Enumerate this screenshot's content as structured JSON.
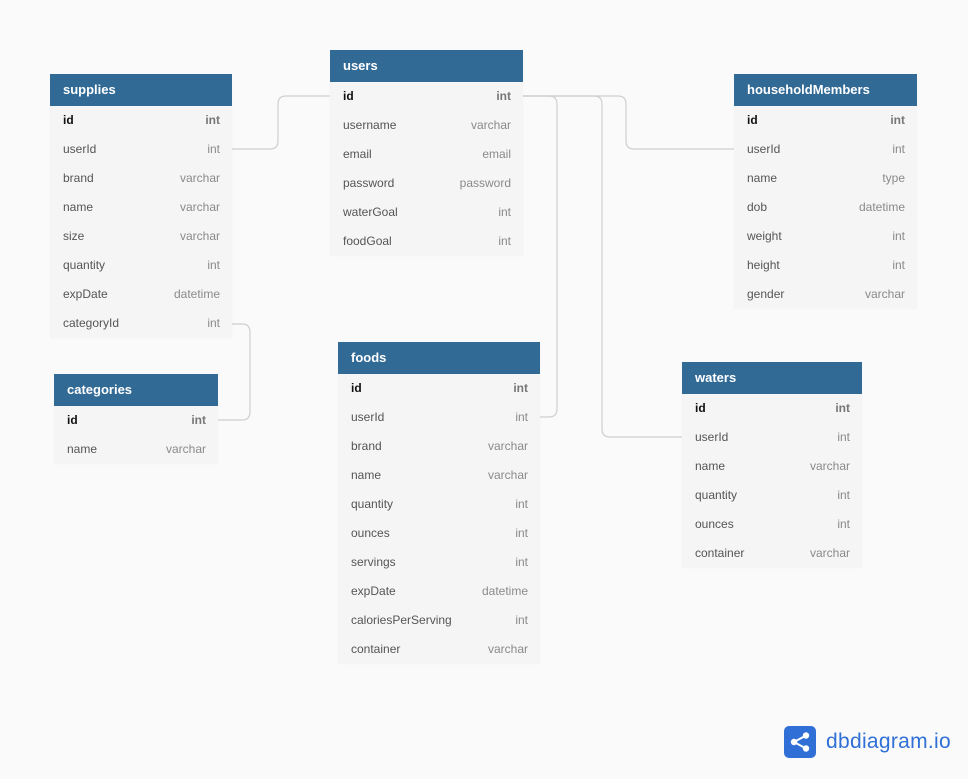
{
  "tables": [
    {
      "id": "supplies",
      "name": "supplies",
      "columns": [
        {
          "name": "id",
          "type": "int",
          "pk": true
        },
        {
          "name": "userId",
          "type": "int"
        },
        {
          "name": "brand",
          "type": "varchar"
        },
        {
          "name": "name",
          "type": "varchar"
        },
        {
          "name": "size",
          "type": "varchar"
        },
        {
          "name": "quantity",
          "type": "int"
        },
        {
          "name": "expDate",
          "type": "datetime"
        },
        {
          "name": "categoryId",
          "type": "int"
        }
      ]
    },
    {
      "id": "users",
      "name": "users",
      "columns": [
        {
          "name": "id",
          "type": "int",
          "pk": true
        },
        {
          "name": "username",
          "type": "varchar"
        },
        {
          "name": "email",
          "type": "email"
        },
        {
          "name": "password",
          "type": "password"
        },
        {
          "name": "waterGoal",
          "type": "int"
        },
        {
          "name": "foodGoal",
          "type": "int"
        }
      ]
    },
    {
      "id": "householdMembers",
      "name": "householdMembers",
      "columns": [
        {
          "name": "id",
          "type": "int",
          "pk": true
        },
        {
          "name": "userId",
          "type": "int"
        },
        {
          "name": "name",
          "type": "type"
        },
        {
          "name": "dob",
          "type": "datetime"
        },
        {
          "name": "weight",
          "type": "int"
        },
        {
          "name": "height",
          "type": "int"
        },
        {
          "name": "gender",
          "type": "varchar"
        }
      ]
    },
    {
      "id": "categories",
      "name": "categories",
      "columns": [
        {
          "name": "id",
          "type": "int",
          "pk": true
        },
        {
          "name": "name",
          "type": "varchar"
        }
      ]
    },
    {
      "id": "foods",
      "name": "foods",
      "columns": [
        {
          "name": "id",
          "type": "int",
          "pk": true
        },
        {
          "name": "userId",
          "type": "int"
        },
        {
          "name": "brand",
          "type": "varchar"
        },
        {
          "name": "name",
          "type": "varchar"
        },
        {
          "name": "quantity",
          "type": "int"
        },
        {
          "name": "ounces",
          "type": "int"
        },
        {
          "name": "servings",
          "type": "int"
        },
        {
          "name": "expDate",
          "type": "datetime"
        },
        {
          "name": "caloriesPerServing",
          "type": "int"
        },
        {
          "name": "container",
          "type": "varchar"
        }
      ]
    },
    {
      "id": "waters",
      "name": "waters",
      "columns": [
        {
          "name": "id",
          "type": "int",
          "pk": true
        },
        {
          "name": "userId",
          "type": "int"
        },
        {
          "name": "name",
          "type": "varchar"
        },
        {
          "name": "quantity",
          "type": "int"
        },
        {
          "name": "ounces",
          "type": "int"
        },
        {
          "name": "container",
          "type": "varchar"
        }
      ]
    }
  ],
  "relationships": [
    {
      "from": "supplies.userId",
      "to": "users.id"
    },
    {
      "from": "supplies.categoryId",
      "to": "categories.id"
    },
    {
      "from": "householdMembers.userId",
      "to": "users.id"
    },
    {
      "from": "foods.userId",
      "to": "users.id"
    },
    {
      "from": "waters.userId",
      "to": "users.id"
    }
  ],
  "colors": {
    "header": "#326a96",
    "background": "#fafafa",
    "row": "#f5f5f5",
    "link": "#cfcfcf",
    "brand": "#2f6fd6"
  },
  "logo": {
    "text": "dbdiagram.io",
    "icon": "share-icon"
  }
}
